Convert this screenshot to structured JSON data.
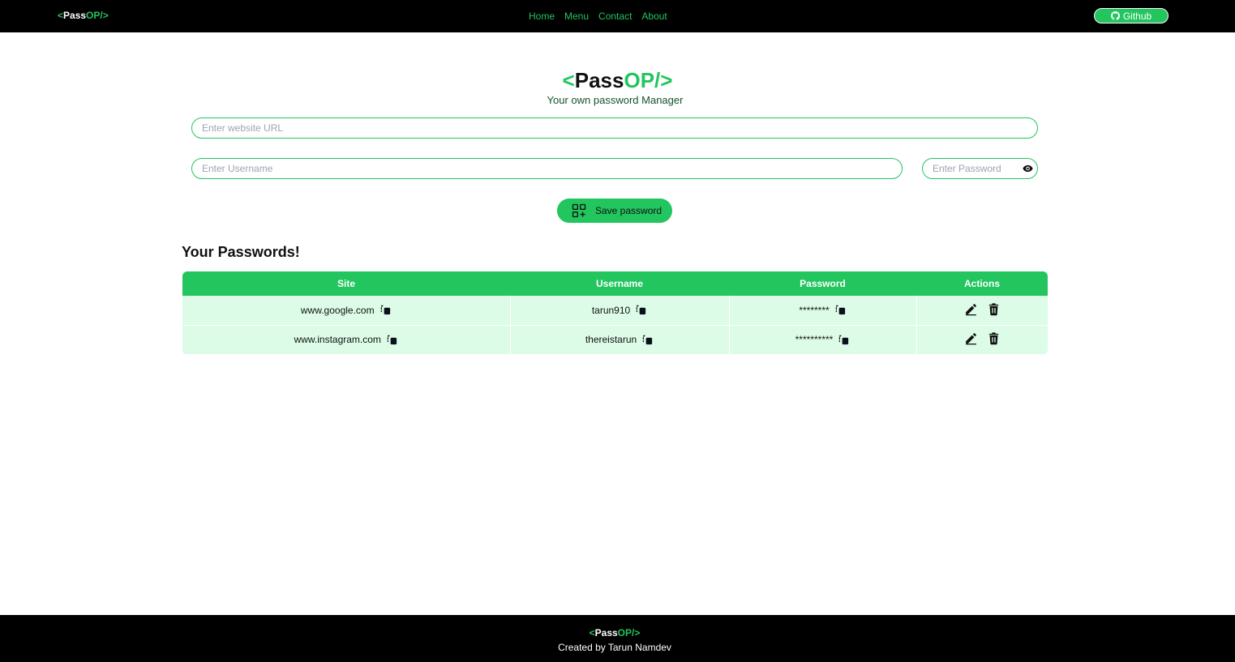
{
  "brand": {
    "lt": "<",
    "pass": "Pass",
    "op": "OP/",
    "gt": ">"
  },
  "nav": {
    "links": [
      "Home",
      "Menu",
      "Contact",
      "About"
    ],
    "github_label": "Github"
  },
  "hero": {
    "tagline": "Your own password Manager"
  },
  "form": {
    "url_placeholder": "Enter website URL",
    "username_placeholder": "Enter Username",
    "password_placeholder": "Enter Password",
    "save_label": "Save password"
  },
  "passwords": {
    "title": "Your Passwords!",
    "columns": [
      "Site",
      "Username",
      "Password",
      "Actions"
    ],
    "rows": [
      {
        "site": "www.google.com",
        "username": "tarun910",
        "password": "********"
      },
      {
        "site": "www.instagram.com",
        "username": "thereistarun",
        "password": "**********"
      }
    ]
  },
  "footer": {
    "credit": "Created by Tarun Namdev"
  },
  "colors": {
    "accent": "#22c55e",
    "row_bg": "#dcfce7",
    "bar_bg": "#000000"
  }
}
